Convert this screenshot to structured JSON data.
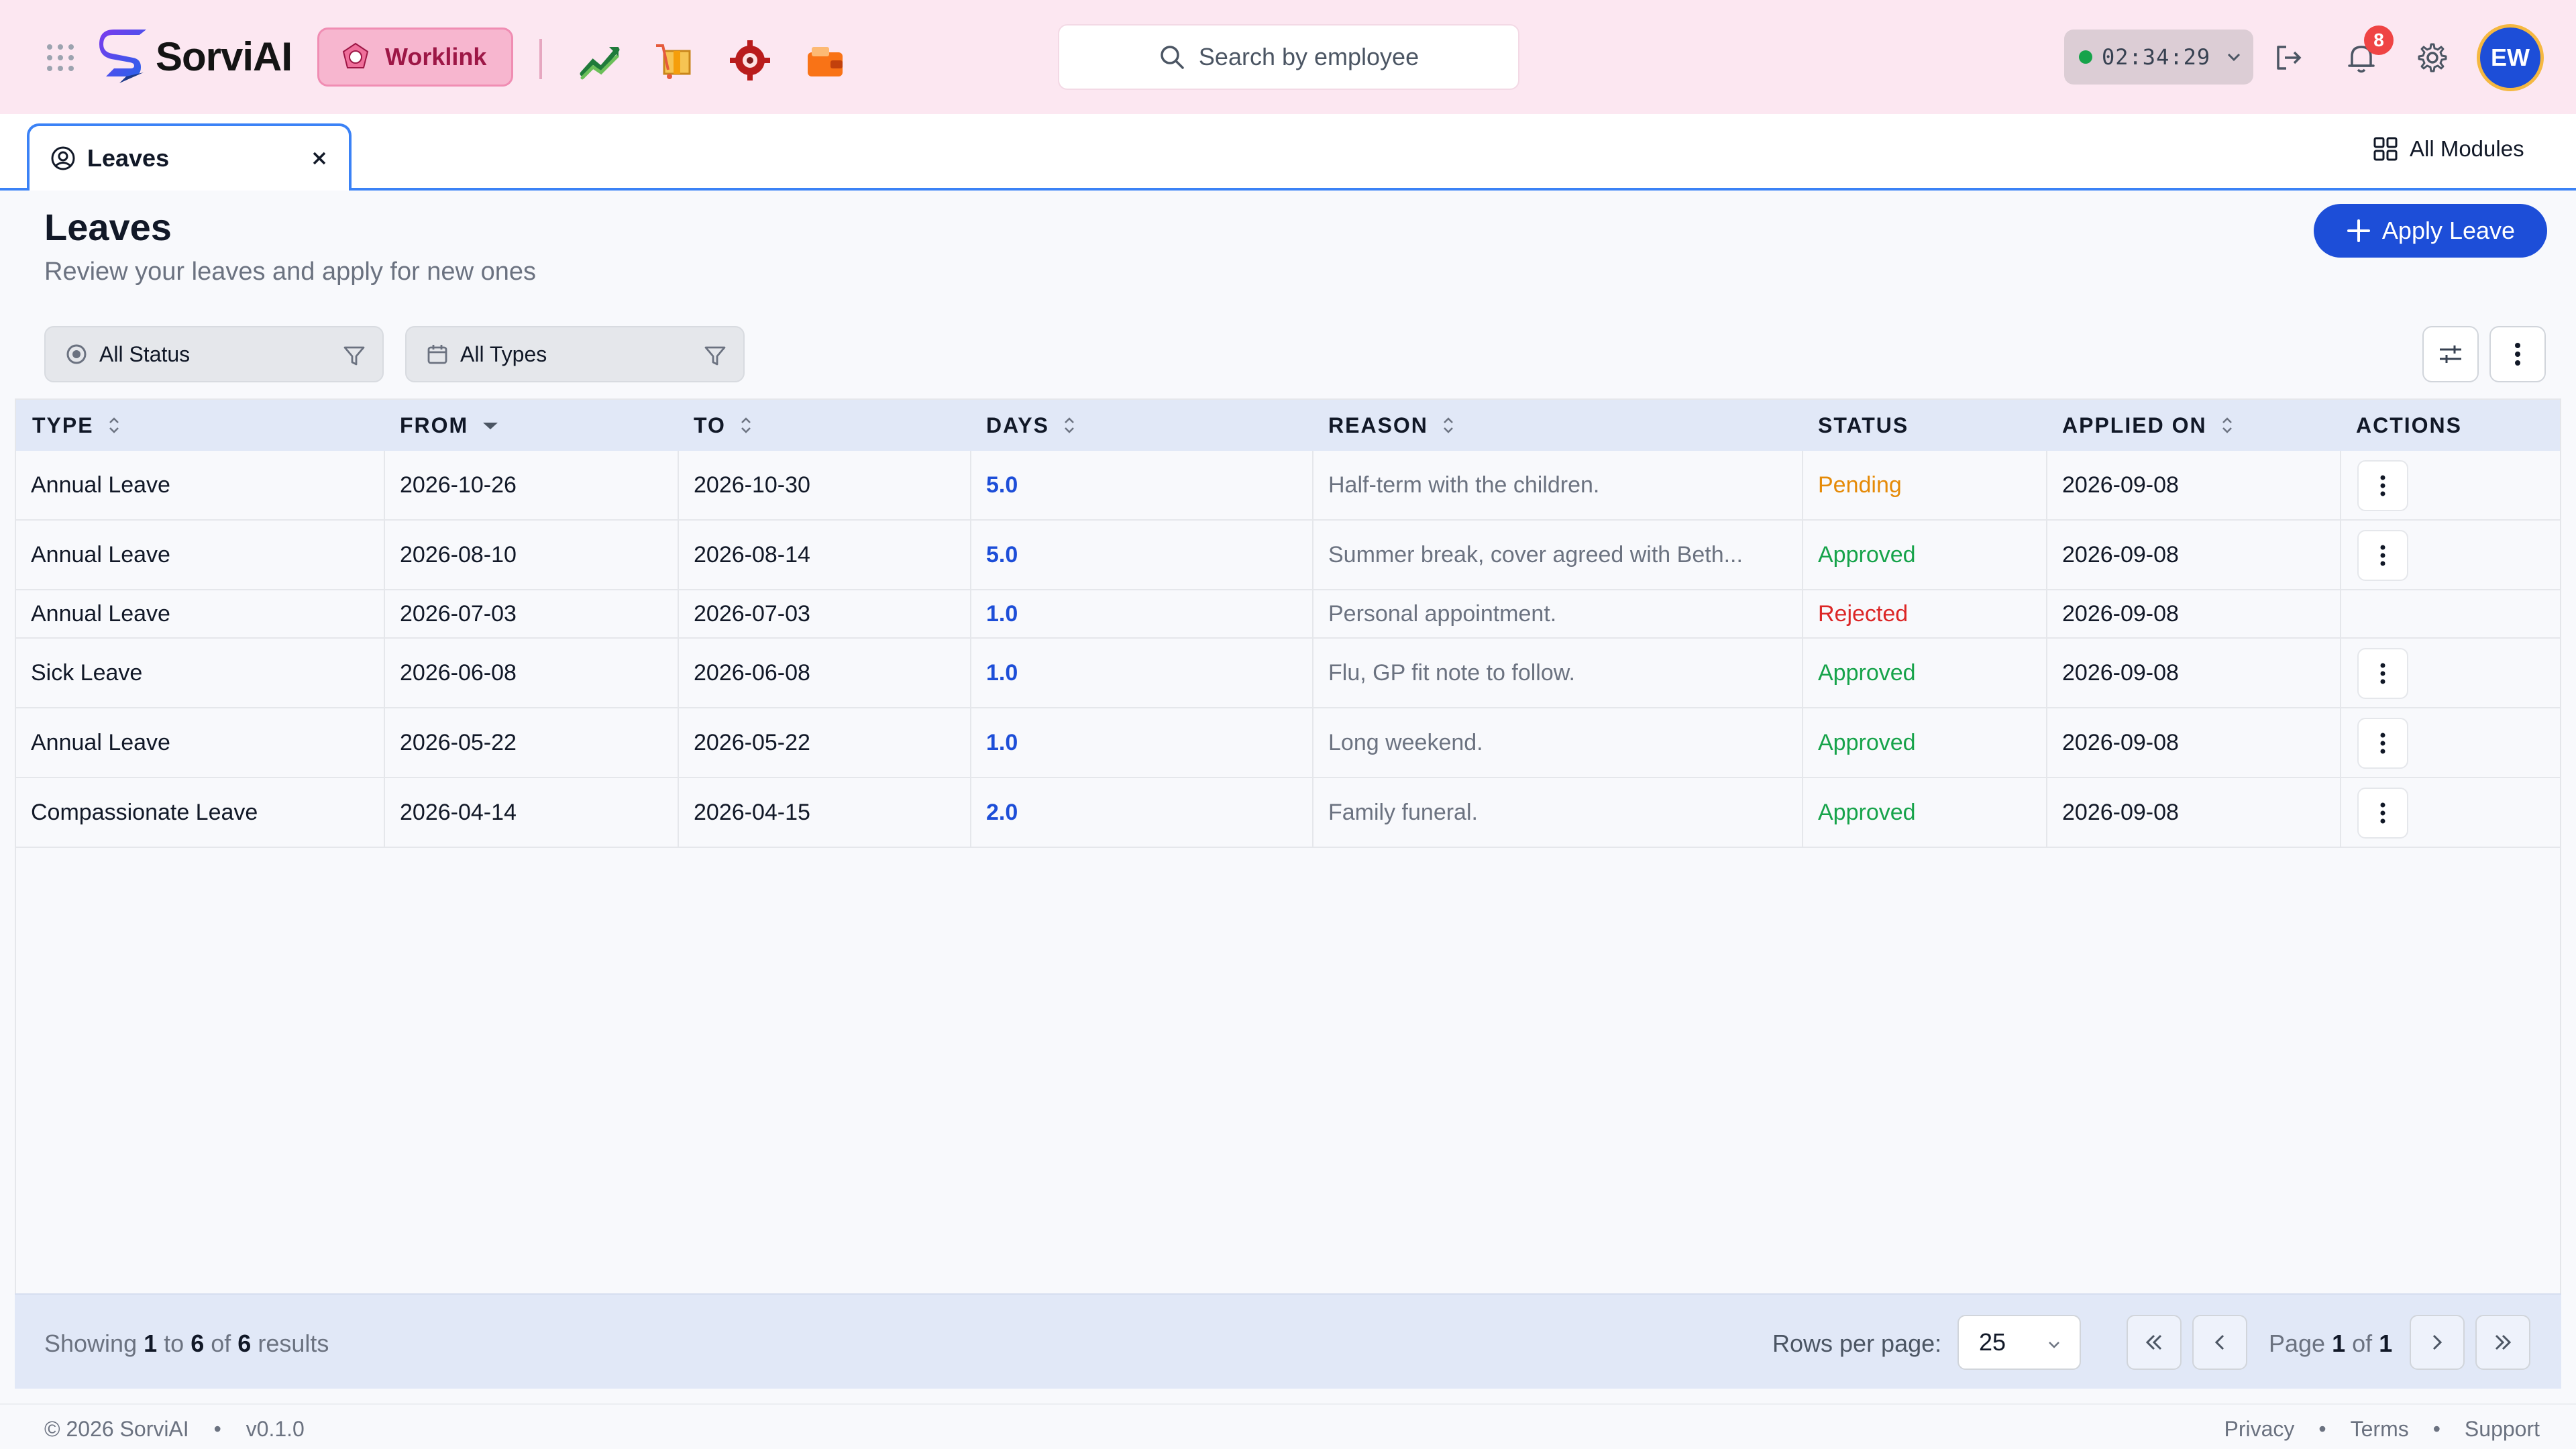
{
  "header": {
    "brand": "SorviAI",
    "module_chip": "Worklink",
    "search_placeholder": "Search by employee",
    "timer": "02:34:29",
    "notification_count": "8",
    "avatar_initials": "EW",
    "colors": {
      "header_bg": "#fce7f1",
      "accent": "#1d4ed8",
      "chip_bg": "#f7b6cf"
    }
  },
  "tabs": [
    {
      "label": "Leaves",
      "active": true
    }
  ],
  "all_modules_label": "All Modules",
  "page": {
    "title": "Leaves",
    "subtitle": "Review your leaves and apply for new ones",
    "apply_button": "Apply Leave"
  },
  "filters": {
    "status": "All Status",
    "type": "All Types"
  },
  "table": {
    "columns": [
      "TYPE",
      "FROM",
      "TO",
      "DAYS",
      "REASON",
      "STATUS",
      "APPLIED ON",
      "ACTIONS"
    ],
    "rows": [
      {
        "type": "Annual Leave",
        "from": "2026-10-26",
        "to": "2026-10-30",
        "days": "5.0",
        "reason": "Half-term with the children.",
        "status": "Pending",
        "applied_on": "2026-09-08",
        "has_actions": true
      },
      {
        "type": "Annual Leave",
        "from": "2026-08-10",
        "to": "2026-08-14",
        "days": "5.0",
        "reason": "Summer break, cover agreed with Beth...",
        "status": "Approved",
        "applied_on": "2026-09-08",
        "has_actions": true
      },
      {
        "type": "Annual Leave",
        "from": "2026-07-03",
        "to": "2026-07-03",
        "days": "1.0",
        "reason": "Personal appointment.",
        "status": "Rejected",
        "applied_on": "2026-09-08",
        "has_actions": false
      },
      {
        "type": "Sick Leave",
        "from": "2026-06-08",
        "to": "2026-06-08",
        "days": "1.0",
        "reason": "Flu, GP fit note to follow.",
        "status": "Approved",
        "applied_on": "2026-09-08",
        "has_actions": true
      },
      {
        "type": "Annual Leave",
        "from": "2026-05-22",
        "to": "2026-05-22",
        "days": "1.0",
        "reason": "Long weekend.",
        "status": "Approved",
        "applied_on": "2026-09-08",
        "has_actions": true
      },
      {
        "type": "Compassionate Leave",
        "from": "2026-04-14",
        "to": "2026-04-15",
        "days": "2.0",
        "reason": "Family funeral.",
        "status": "Approved",
        "applied_on": "2026-09-08",
        "has_actions": true
      }
    ]
  },
  "pagination": {
    "showing_prefix": "Showing",
    "start": "1",
    "to_word": "to",
    "end": "6",
    "of_word": "of",
    "total": "6",
    "results_word": "results",
    "rows_per_page_label": "Rows per page:",
    "rows_per_page": "25",
    "page_word": "Page",
    "current_page": "1",
    "page_of": "of",
    "total_pages": "1"
  },
  "footer": {
    "copyright": "© 2026 SorviAI",
    "version": "v0.1.0",
    "links": [
      "Privacy",
      "Terms",
      "Support"
    ]
  }
}
